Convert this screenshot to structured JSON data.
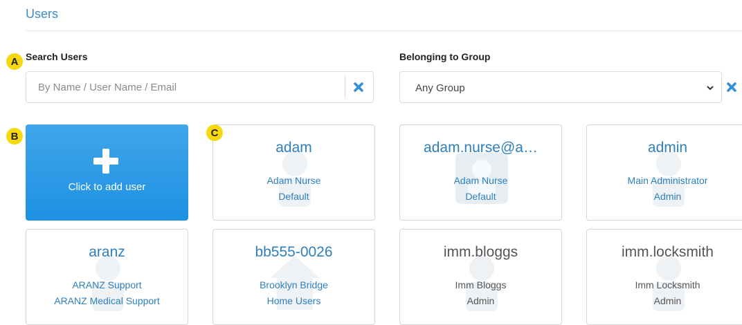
{
  "page": {
    "title": "Users"
  },
  "search": {
    "label": "Search Users",
    "placeholder": "By Name / User Name / Email",
    "value": ""
  },
  "group_filter": {
    "label": "Belonging to Group",
    "selected": "Any Group"
  },
  "markers": {
    "a": "A",
    "b": "B",
    "c": "C"
  },
  "add_card": {
    "label": "Click to add user"
  },
  "users": [
    {
      "username": "adam",
      "full_name": "Adam Nurse",
      "group": "Default"
    },
    {
      "username": "adam.nurse@a…",
      "full_name": "Adam Nurse",
      "group": "Default"
    },
    {
      "username": "admin",
      "full_name": "Main Administrator",
      "group": "Admin"
    },
    {
      "username": "aranz",
      "full_name": "ARANZ Support",
      "group": "ARANZ Medical Support"
    },
    {
      "username": "bb555-0026",
      "full_name": "Brooklyn Bridge",
      "group": "Home Users"
    },
    {
      "username": "imm.bloggs",
      "full_name": "Imm Bloggs",
      "group": "Admin"
    },
    {
      "username": "imm.locksmith",
      "full_name": "Imm Locksmith",
      "group": "Admin"
    }
  ],
  "colors": {
    "accent": "#1e91e3",
    "link": "#2d7fbd",
    "marker": "#f7d80f"
  }
}
